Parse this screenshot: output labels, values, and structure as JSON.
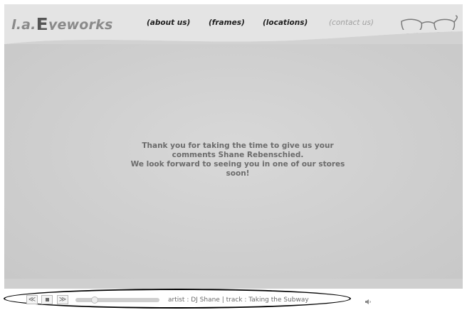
{
  "header": {
    "logo": {
      "prefix": "l.a.",
      "big_letter": "E",
      "suffix": "yeworks"
    },
    "nav": [
      {
        "label": "(about us)"
      },
      {
        "label": "(frames)"
      },
      {
        "label": "(locations)"
      },
      {
        "label": "(contact us)"
      }
    ]
  },
  "message": {
    "lines": [
      "Thank you for taking the time to give us your",
      "comments Shane Rebenschied.",
      "We look forward to seeing you in one of our stores",
      "soon!"
    ]
  },
  "player": {
    "prev_icon": "≪",
    "next_icon": "≫",
    "track_text": "artist : DJ Shane  |  track : Taking the Subway",
    "progress": 0.2
  },
  "colors": {
    "background": "#cfcfcf",
    "header": "#e4e4e4",
    "nav_active": "#1e1e1e",
    "nav_dim": "#a0a0a0",
    "message_text": "#6b6b6b"
  },
  "icons": [
    "glasses-icon",
    "prev-track-icon",
    "stop-icon",
    "next-track-icon",
    "speaker-icon"
  ]
}
